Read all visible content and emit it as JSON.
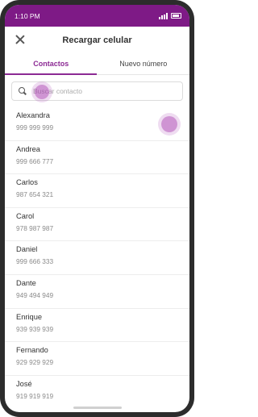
{
  "status_bar": {
    "time": "1:10 PM"
  },
  "header": {
    "title": "Recargar celular",
    "close_icon": "close-icon"
  },
  "tabs": [
    {
      "label": "Contactos",
      "active": true
    },
    {
      "label": "Nuevo número",
      "active": false
    }
  ],
  "search": {
    "placeholder": "Buscar contacto",
    "value": ""
  },
  "contacts": [
    {
      "name": "Alexandra",
      "phone": "999 999 999"
    },
    {
      "name": "Andrea",
      "phone": "999 666 777"
    },
    {
      "name": "Carlos",
      "phone": "987 654 321"
    },
    {
      "name": "Carol",
      "phone": "978 987 987"
    },
    {
      "name": "Daniel",
      "phone": "999 666 333"
    },
    {
      "name": "Dante",
      "phone": "949 494 949"
    },
    {
      "name": "Enrique",
      "phone": "939 939 939"
    },
    {
      "name": "Fernando",
      "phone": "929 929 929"
    },
    {
      "name": "José",
      "phone": "919 919 919"
    }
  ],
  "colors": {
    "accent": "#8c2a94",
    "status_bar": "#7e1a86",
    "touch": "#a83caf"
  }
}
